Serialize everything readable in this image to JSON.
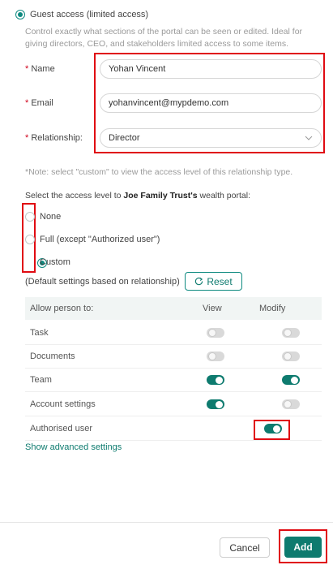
{
  "access": {
    "guest_label": "Guest access (limited access)",
    "description": "Control exactly what sections of the portal can be seen or edited. Ideal for giving directors, CEO, and stakeholders limited access to some items."
  },
  "form": {
    "name_label": "Name",
    "name_value": "Yohan Vincent",
    "email_label": "Email",
    "email_value": "yohanvincent@mypdemo.com",
    "relationship_label": "Relationship:",
    "relationship_value": "Director",
    "required_mark": "*"
  },
  "note": "*Note: select \"custom\" to view the access level of this relationship type.",
  "access_level": {
    "prefix": "Select the access level to",
    "entity": "Joe Family Trust's",
    "suffix": "wealth portal:",
    "options": [
      "None",
      "Full (except \"Authorized user\")",
      "Custom"
    ],
    "selected": "Custom"
  },
  "defaults_text": "(Default settings based on relationship)",
  "reset_label": "Reset",
  "permissions": {
    "header_allow": "Allow person to:",
    "header_view": "View",
    "header_modify": "Modify",
    "rows": [
      {
        "label": "Task",
        "view": false,
        "modify": false
      },
      {
        "label": "Documents",
        "view": false,
        "modify": false
      },
      {
        "label": "Team",
        "view": true,
        "modify": true
      },
      {
        "label": "Account settings",
        "view": true,
        "modify": false
      },
      {
        "label": "Authorised user",
        "view": null,
        "modify": true
      }
    ]
  },
  "advanced_link": "Show advanced settings",
  "footer": {
    "cancel_label": "Cancel",
    "add_label": "Add"
  },
  "colors": {
    "accent": "#0e7b6f",
    "highlight": "#e00b12"
  }
}
